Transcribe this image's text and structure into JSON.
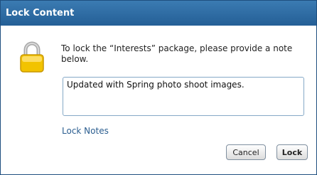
{
  "dialog": {
    "title": "Lock Content",
    "message": "To lock the “Interests” package, please provide a note below.",
    "note_value": "Updated with Spring photo shoot images.",
    "lock_notes_link": "Lock Notes",
    "buttons": {
      "cancel": "Cancel",
      "lock": "Lock"
    },
    "icon": "padlock-icon"
  },
  "colors": {
    "titlebar": "#2f6da5",
    "link": "#2a5d8f",
    "padlock_body": "#f2c300",
    "padlock_shackle": "#a7a7a7"
  }
}
